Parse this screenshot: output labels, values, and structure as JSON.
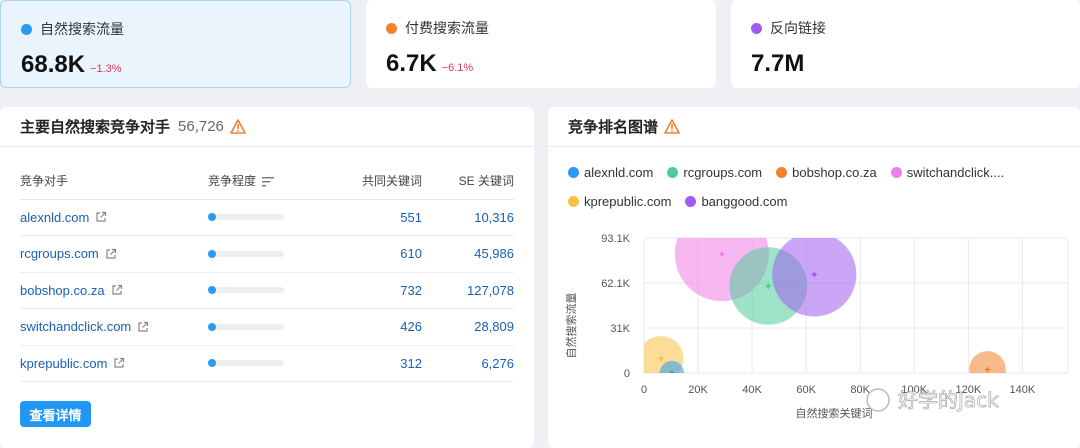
{
  "metrics": [
    {
      "label": "自然搜索流量",
      "value": "68.8K",
      "delta": "−1.3%",
      "color": "#2b9af3"
    },
    {
      "label": "付费搜索流量",
      "value": "6.7K",
      "delta": "−6.1%",
      "color": "#f0822e"
    },
    {
      "label": "反向链接",
      "value": "7.7M",
      "delta": "",
      "color": "#a05cf0"
    }
  ],
  "competitors": {
    "title": "主要自然搜索竞争对手",
    "count": "56,726",
    "columns": {
      "competitor": "竞争对手",
      "level": "竞争程度",
      "common": "共同关键词",
      "se": "SE 关键词"
    },
    "rows": [
      {
        "domain": "alexnld.com",
        "level": 0.05,
        "common": "551",
        "se": "10,316"
      },
      {
        "domain": "rcgroups.com",
        "level": 0.05,
        "common": "610",
        "se": "45,986"
      },
      {
        "domain": "bobshop.co.za",
        "level": 0.05,
        "common": "732",
        "se": "127,078"
      },
      {
        "domain": "switchandclick.com",
        "level": 0.05,
        "common": "426",
        "se": "28,809"
      },
      {
        "domain": "kprepublic.com",
        "level": 0.05,
        "common": "312",
        "se": "6,276"
      }
    ],
    "button": "查看详情"
  },
  "map": {
    "title": "竞争排名图谱",
    "legend": [
      {
        "name": "alexnld.com",
        "color": "#2b9af3"
      },
      {
        "name": "rcgroups.com",
        "color": "#4fcc9a"
      },
      {
        "name": "bobshop.co.za",
        "color": "#f0822e"
      },
      {
        "name": "switchandclick....",
        "color": "#f07ee8"
      },
      {
        "name": "kprepublic.com",
        "color": "#f6c343"
      },
      {
        "name": "banggood.com",
        "color": "#a05cf0"
      }
    ],
    "watermark": "好学的Jack"
  },
  "chart_data": {
    "type": "scatter",
    "xlabel": "自然搜索关键词",
    "ylabel": "自然搜索流量",
    "xticks": [
      "0",
      "20K",
      "40K",
      "60K",
      "80K",
      "100K",
      "120K",
      "140K"
    ],
    "yticks": [
      "0",
      "31K",
      "62.1K",
      "93.1K"
    ],
    "xlim": [
      0,
      150000
    ],
    "ylim": [
      0,
      93100
    ],
    "grid": true,
    "series": [
      {
        "name": "switchandclick....",
        "color": "#f07ee8",
        "x": 28809,
        "y": 82000,
        "size": 1.0
      },
      {
        "name": "rcgroups.com",
        "color": "#4fcc9a",
        "x": 45986,
        "y": 60000,
        "size": 0.8
      },
      {
        "name": "banggood.com",
        "color": "#a05cf0",
        "x": 63000,
        "y": 68000,
        "size": 0.88
      },
      {
        "name": "kprepublic.com",
        "color": "#f6c343",
        "x": 6276,
        "y": 10000,
        "size": 0.4
      },
      {
        "name": "alexnld.com",
        "color": "#2b9af3",
        "x": 10316,
        "y": 0,
        "size": 0.15
      },
      {
        "name": "bobshop.co.za",
        "color": "#f0822e",
        "x": 127078,
        "y": 2500,
        "size": 0.3
      }
    ]
  }
}
